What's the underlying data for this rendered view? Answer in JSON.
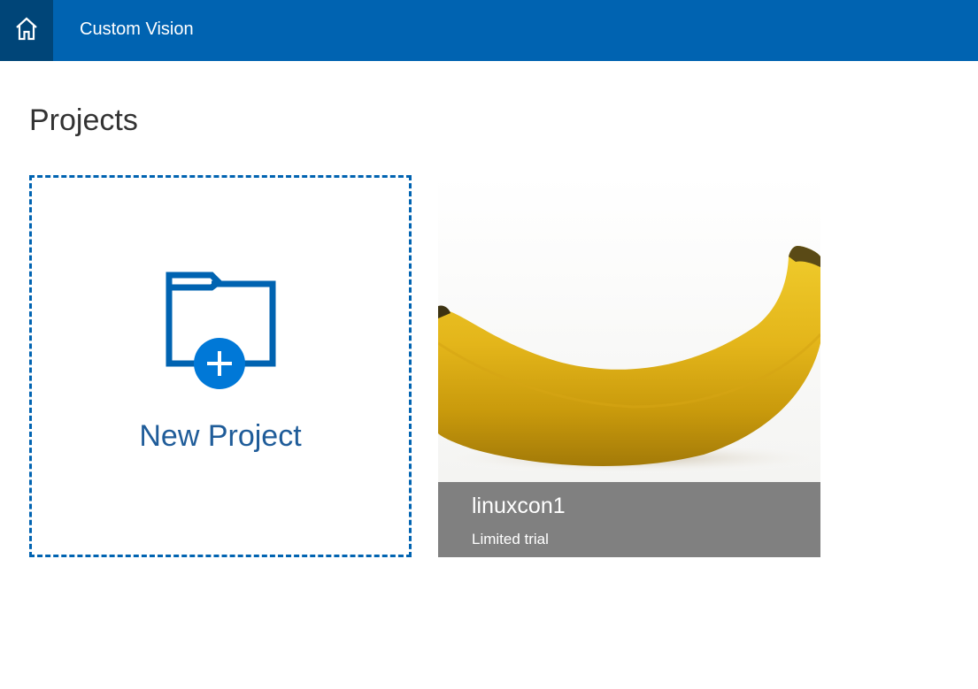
{
  "header": {
    "app_title": "Custom Vision",
    "home_icon": "home-icon",
    "bar_color": "#0063b1",
    "home_bg_color": "#004578"
  },
  "page": {
    "title": "Projects"
  },
  "new_project": {
    "label": "New Project",
    "icon": "folder-add-icon",
    "accent_color": "#0063b1"
  },
  "projects": [
    {
      "name": "linuxcon1",
      "tier": "Limited trial",
      "thumbnail": "banana-image",
      "caption_color": "#808080"
    }
  ]
}
